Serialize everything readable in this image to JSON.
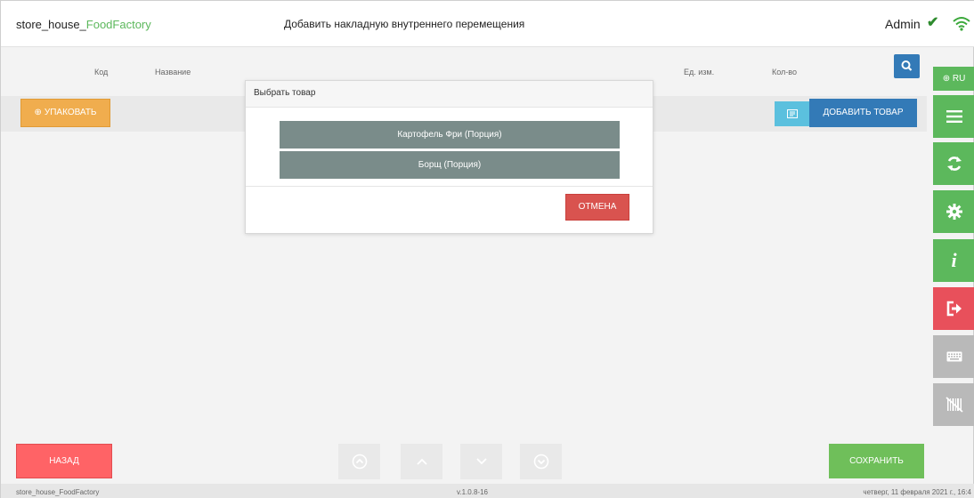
{
  "header": {
    "app_title_prefix": "store_house_",
    "app_title_highlight": "FoodFactory",
    "page_title": "Добавить накладную внутреннего перемещения",
    "user": "Admin"
  },
  "table": {
    "columns": [
      "Код",
      "Название",
      "Ед. изм.",
      "Кол-во"
    ]
  },
  "toolbar": {
    "pack_label": "УПАКОВАТЬ",
    "add_label": "ДОБАВИТЬ ТОВАР"
  },
  "sidebar": {
    "language": "RU"
  },
  "modal": {
    "title": "Выбрать товар",
    "items": [
      {
        "label": "Картофель Фри  (Порция)"
      },
      {
        "label": "Борщ  (Порция)"
      }
    ],
    "cancel_label": "ОТМЕНА"
  },
  "footer": {
    "back_label": "НАЗАД",
    "save_label": "СОХРАНИТЬ"
  },
  "status": {
    "left": "store_house_FoodFactory",
    "version": "v.1.0.8-16",
    "datetime": "четверг, 11 февраля 2021 г., 16:4"
  },
  "colors": {
    "accent_green": "#5cb85c",
    "primary_blue": "#337ab7",
    "danger_red": "#d9534f",
    "warning_orange": "#f0ad4e",
    "item_grey": "#7a8c8a"
  },
  "icons": {
    "status_ok": "check-icon",
    "connection": "wifi-icon",
    "search": "search-icon",
    "pack": "box-icon",
    "barcode_scan": "barcode-card-icon",
    "language": "globe-icon",
    "menu": "menu-icon",
    "sync": "sync-icon",
    "settings": "gear-icon",
    "info": "info-icon",
    "logout": "logout-icon",
    "keyboard": "keyboard-icon",
    "no_barcode": "no-barcode-icon"
  }
}
